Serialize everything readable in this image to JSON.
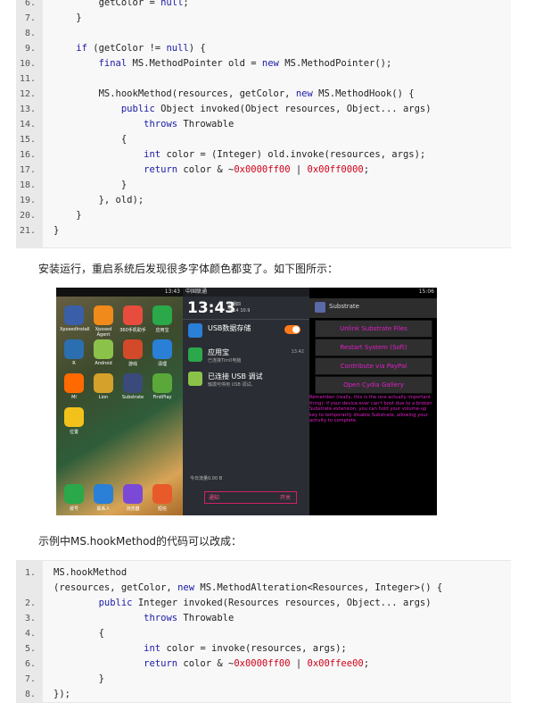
{
  "code1": {
    "lines": [
      {
        "n": "6.",
        "segs": [
          {
            "t": "        getColor = "
          },
          {
            "t": "null",
            "c": "kw"
          },
          {
            "t": ";"
          }
        ]
      },
      {
        "n": "7.",
        "segs": [
          {
            "t": "    }"
          }
        ]
      },
      {
        "n": "8.",
        "segs": [
          {
            "t": ""
          }
        ]
      },
      {
        "n": "9.",
        "segs": [
          {
            "t": "    "
          },
          {
            "t": "if",
            "c": "kw"
          },
          {
            "t": " (getColor != "
          },
          {
            "t": "null",
            "c": "kw"
          },
          {
            "t": ") {"
          }
        ]
      },
      {
        "n": "10.",
        "segs": [
          {
            "t": "        "
          },
          {
            "t": "final",
            "c": "kw"
          },
          {
            "t": " MS.MethodPointer old = "
          },
          {
            "t": "new",
            "c": "kw"
          },
          {
            "t": " MS.MethodPointer();"
          }
        ]
      },
      {
        "n": "11.",
        "segs": [
          {
            "t": ""
          }
        ]
      },
      {
        "n": "12.",
        "segs": [
          {
            "t": "        MS.hookMethod(resources, getColor, "
          },
          {
            "t": "new",
            "c": "kw"
          },
          {
            "t": " MS.MethodHook() {"
          }
        ]
      },
      {
        "n": "13.",
        "segs": [
          {
            "t": "            "
          },
          {
            "t": "public",
            "c": "kw"
          },
          {
            "t": " Object invoked(Object resources, Object... args)"
          }
        ]
      },
      {
        "n": "14.",
        "segs": [
          {
            "t": "                "
          },
          {
            "t": "throws",
            "c": "kw"
          },
          {
            "t": " Throwable"
          }
        ]
      },
      {
        "n": "15.",
        "segs": [
          {
            "t": "            {"
          }
        ]
      },
      {
        "n": "16.",
        "segs": [
          {
            "t": "                "
          },
          {
            "t": "int",
            "c": "kw"
          },
          {
            "t": " color = (Integer) old.invoke(resources, args);"
          }
        ]
      },
      {
        "n": "17.",
        "segs": [
          {
            "t": "                "
          },
          {
            "t": "return",
            "c": "kw"
          },
          {
            "t": " color & ~"
          },
          {
            "t": "0x0000ff00",
            "c": "nm"
          },
          {
            "t": " | "
          },
          {
            "t": "0x00ff0000",
            "c": "nm"
          },
          {
            "t": ";"
          }
        ]
      },
      {
        "n": "18.",
        "segs": [
          {
            "t": "            }"
          }
        ]
      },
      {
        "n": "19.",
        "segs": [
          {
            "t": "        }, old);"
          }
        ]
      },
      {
        "n": "20.",
        "segs": [
          {
            "t": "    }"
          }
        ]
      },
      {
        "n": "21.",
        "segs": [
          {
            "t": "}"
          }
        ]
      }
    ]
  },
  "para1": "安装运行，重启系统后发现很多字体颜色都变了。如下图所示：",
  "para2": "示例中MS.hookMethod的代码可以改成：",
  "screenshot": {
    "left": {
      "status_time": "13:43",
      "apps": [
        {
          "label": "XposedInstall",
          "color": "#3a5fa8"
        },
        {
          "label": "Xposed Agent",
          "color": "#f08a1a"
        },
        {
          "label": "360手机助手",
          "color": "#e84c3d"
        },
        {
          "label": "应用宝",
          "color": "#2aa84a"
        },
        {
          "label": "R",
          "color": "#2c6fb0"
        },
        {
          "label": "Android",
          "color": "#8bc34a"
        },
        {
          "label": "游戏",
          "color": "#d24a2a"
        },
        {
          "label": "清理",
          "color": "#2a7fd6"
        },
        {
          "label": "MI",
          "color": "#ff6a00"
        },
        {
          "label": "Lion",
          "color": "#d6a12a"
        },
        {
          "label": "Substrate",
          "color": "#3a4a7a"
        },
        {
          "label": "FirstPlay",
          "color": "#5aa83a"
        },
        {
          "label": "位置",
          "color": "#f3c21a"
        }
      ],
      "dock": [
        {
          "label": "拨号",
          "color": "#2aa84a"
        },
        {
          "label": "联系人",
          "color": "#2a7fd6"
        },
        {
          "label": "浏览器",
          "color": "#7a4ad6"
        },
        {
          "label": "短信",
          "color": "#e85a2a"
        }
      ]
    },
    "middle": {
      "carrier": "中国联通",
      "time": "13:43",
      "date": "2014 10.9",
      "weekday": "星期四",
      "notifications": [
        {
          "title": "USB数据存储",
          "sub": "",
          "color": "#2a7fd6"
        },
        {
          "title": "应用宝",
          "sub": "已连接Tim0电脑",
          "time": "13:42",
          "color": "#2aa84a"
        },
        {
          "title": "已连接 USB 调试",
          "sub": "触摸可停用 USB 调试。",
          "color": "#8bc34a"
        }
      ],
      "footer": "今日流量0.00 B",
      "tab_left": "通知",
      "tab_right": "开关"
    },
    "right": {
      "status_time": "15:06",
      "title": "Substrate",
      "buttons": [
        "Unlink Substrate Files",
        "Restart System (Soft)",
        "Contribute via PayPal",
        "Open Cydia Gallery"
      ],
      "note": "Remember (really, this is the one actually important thing): if your device ever can't boot due to a broken Substrate extension, you can hold your volume-up key to temporarily disable Substrate, allowing your activity to complete."
    }
  },
  "code2": {
    "lines": [
      {
        "n": "1.",
        "segs": [
          {
            "t": "MS.hookMethod"
          }
        ]
      },
      {
        "n": "",
        "segs": [
          {
            "t": "(resources, getColor, "
          },
          {
            "t": "new",
            "c": "kw"
          },
          {
            "t": " MS.MethodAlteration<Resources, Integer>() {"
          }
        ]
      },
      {
        "n": "2.",
        "segs": [
          {
            "t": "        "
          },
          {
            "t": "public",
            "c": "kw"
          },
          {
            "t": " Integer invoked(Resources resources, Object... args)"
          }
        ]
      },
      {
        "n": "3.",
        "segs": [
          {
            "t": "                "
          },
          {
            "t": "throws",
            "c": "kw"
          },
          {
            "t": " Throwable"
          }
        ]
      },
      {
        "n": "4.",
        "segs": [
          {
            "t": "        {"
          }
        ]
      },
      {
        "n": "5.",
        "segs": [
          {
            "t": "                "
          },
          {
            "t": "int",
            "c": "kw"
          },
          {
            "t": " color = invoke(resources, args);"
          }
        ]
      },
      {
        "n": "6.",
        "segs": [
          {
            "t": "                "
          },
          {
            "t": "return",
            "c": "kw"
          },
          {
            "t": " color & ~"
          },
          {
            "t": "0x0000ff00",
            "c": "nm"
          },
          {
            "t": " | "
          },
          {
            "t": "0x00ffee00",
            "c": "nm"
          },
          {
            "t": ";"
          }
        ]
      },
      {
        "n": "7.",
        "segs": [
          {
            "t": "        }"
          }
        ]
      },
      {
        "n": "8.",
        "segs": [
          {
            "t": "});"
          }
        ]
      }
    ]
  }
}
